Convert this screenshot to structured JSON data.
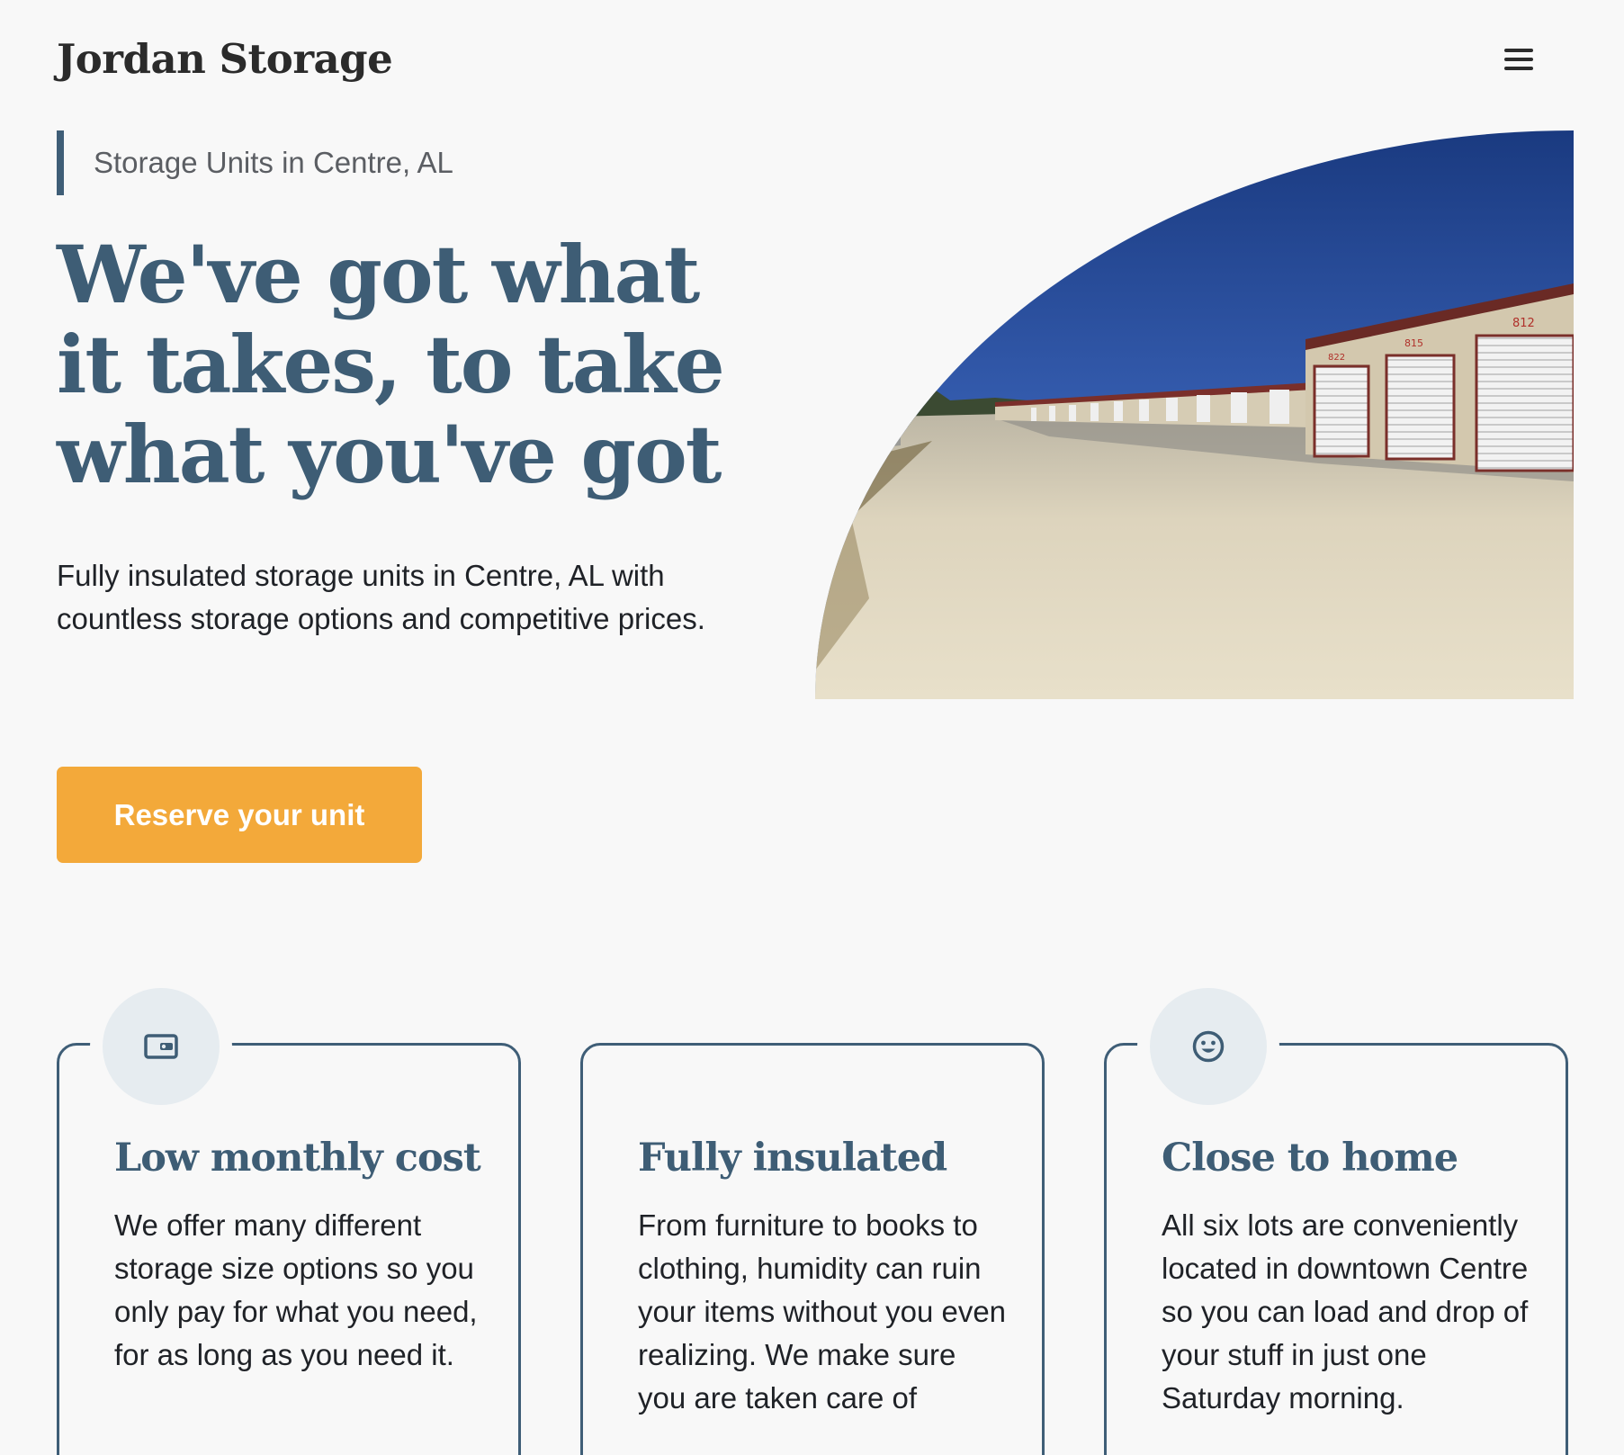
{
  "header": {
    "brand": "Jordan Storage",
    "menu_icon": "hamburger-menu-icon"
  },
  "hero": {
    "eyebrow": "Storage Units in Centre, AL",
    "headline": "We've got what it takes, to take what you've got",
    "lead": "Fully insulated storage units in Centre, AL with countless storage options and competitive prices.",
    "cta_label": "Reserve your unit",
    "photo_alt": "Storage units in Centre, AL",
    "unit_numbers": [
      "812",
      "815",
      "822"
    ]
  },
  "features": [
    {
      "icon": "wallet-icon",
      "title": "Low monthly cost",
      "text": "We offer many different storage size options so you only pay for what you need, for as long as you need it."
    },
    {
      "icon": "",
      "title": "Fully insulated",
      "text": "From furniture to books to clothing, humidity can ruin your items without you even realizing. We make sure you are taken care of"
    },
    {
      "icon": "smile-icon",
      "title": "Close to home",
      "text": "All six lots are conveniently located in downtown Centre so you can load and drop of your stuff in just one Saturday morning."
    }
  ],
  "colors": {
    "background": "#f8f8f8",
    "primary": "#3e5d75",
    "accent": "#f3a93a",
    "badge_bg": "#e6ecf0"
  }
}
